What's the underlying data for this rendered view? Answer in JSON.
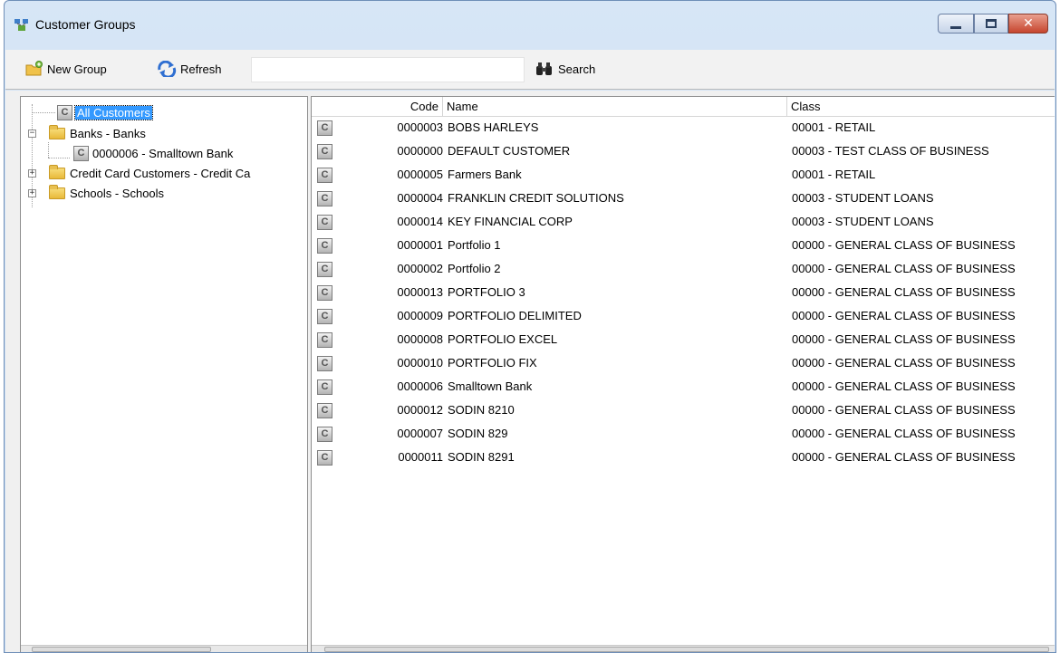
{
  "window": {
    "title": "Customer Groups",
    "accent": "#3399ff"
  },
  "toolbar": {
    "new_group_label": "New Group",
    "refresh_label": "Refresh",
    "search_value": "",
    "search_label": "Search"
  },
  "tree": {
    "items": [
      {
        "label": "All Customers",
        "icon": "customer-icon",
        "selected": true
      },
      {
        "label": "Banks - Banks",
        "icon": "folder-icon",
        "expanded": true
      },
      {
        "label": "0000006 - Smalltown Bank",
        "icon": "customer-icon"
      },
      {
        "label": "Credit Card Customers - Credit Ca",
        "icon": "folder-icon",
        "expanded": false
      },
      {
        "label": "Schools - Schools",
        "icon": "folder-icon",
        "expanded": false
      }
    ]
  },
  "grid": {
    "columns": {
      "code": "Code",
      "name": "Name",
      "class": "Class"
    },
    "rows": [
      {
        "code": "0000003",
        "name": "BOBS HARLEYS",
        "class": "00001 - RETAIL"
      },
      {
        "code": "0000000",
        "name": "DEFAULT CUSTOMER",
        "class": "00003 - TEST CLASS OF BUSINESS"
      },
      {
        "code": "0000005",
        "name": "Farmers Bank",
        "class": "00001 - RETAIL"
      },
      {
        "code": "0000004",
        "name": "FRANKLIN CREDIT SOLUTIONS",
        "class": "00003 - STUDENT LOANS"
      },
      {
        "code": "0000014",
        "name": "KEY FINANCIAL CORP",
        "class": "00003 - STUDENT LOANS"
      },
      {
        "code": "0000001",
        "name": "Portfolio 1",
        "class": "00000 - GENERAL CLASS OF BUSINESS"
      },
      {
        "code": "0000002",
        "name": "Portfolio 2",
        "class": "00000 - GENERAL CLASS OF BUSINESS"
      },
      {
        "code": "0000013",
        "name": "PORTFOLIO 3",
        "class": "00000 - GENERAL CLASS OF BUSINESS"
      },
      {
        "code": "0000009",
        "name": "PORTFOLIO DELIMITED",
        "class": "00000 - GENERAL CLASS OF BUSINESS"
      },
      {
        "code": "0000008",
        "name": "PORTFOLIO EXCEL",
        "class": "00000 - GENERAL CLASS OF BUSINESS"
      },
      {
        "code": "0000010",
        "name": "PORTFOLIO FIX",
        "class": "00000 - GENERAL CLASS OF BUSINESS"
      },
      {
        "code": "0000006",
        "name": "Smalltown Bank",
        "class": "00000 - GENERAL CLASS OF BUSINESS"
      },
      {
        "code": "0000012",
        "name": "SODIN 8210",
        "class": "00000 - GENERAL CLASS OF BUSINESS"
      },
      {
        "code": "0000007",
        "name": "SODIN 829",
        "class": "00000 - GENERAL CLASS OF BUSINESS"
      },
      {
        "code": "0000011",
        "name": "SODIN 8291",
        "class": "00000 - GENERAL CLASS OF BUSINESS"
      }
    ]
  }
}
